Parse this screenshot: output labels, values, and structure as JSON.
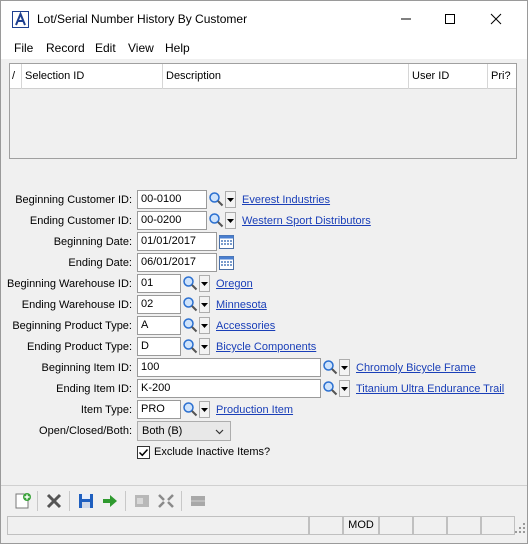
{
  "window": {
    "title": "Lot/Serial Number History By Customer"
  },
  "menu": [
    "File",
    "Record",
    "Edit",
    "View",
    "Help"
  ],
  "grid": {
    "columns": [
      "/",
      "Selection ID",
      "Description",
      "User ID",
      "Pri?"
    ]
  },
  "form": {
    "beginning_customer": {
      "label": "Beginning Customer ID:",
      "value": "00-0100",
      "link": "Everest Industries"
    },
    "ending_customer": {
      "label": "Ending Customer ID:",
      "value": "00-0200",
      "link": "Western Sport Distributors"
    },
    "beginning_date": {
      "label": "Beginning Date:",
      "value": "01/01/2017"
    },
    "ending_date": {
      "label": "Ending Date:",
      "value": "06/01/2017"
    },
    "beginning_warehouse": {
      "label": "Beginning Warehouse ID:",
      "value": "01",
      "link": "Oregon"
    },
    "ending_warehouse": {
      "label": "Ending Warehouse ID:",
      "value": "02",
      "link": "Minnesota"
    },
    "beginning_product_type": {
      "label": "Beginning Product Type:",
      "value": "A",
      "link": "Accessories"
    },
    "ending_product_type": {
      "label": "Ending Product Type:",
      "value": "D",
      "link": "Bicycle Components"
    },
    "beginning_item": {
      "label": "Beginning Item ID:",
      "value": "100",
      "link": "Chromoly Bicycle Frame"
    },
    "ending_item": {
      "label": "Ending Item ID:",
      "value": "K-200",
      "link": "Titanium Ultra Endurance Trail"
    },
    "item_type": {
      "label": "Item Type:",
      "value": "PRO",
      "link": "Production Item"
    },
    "open_closed": {
      "label": "Open/Closed/Both:",
      "value": "Both (B)"
    },
    "exclude_inactive": {
      "label": "Exclude Inactive Items?",
      "checked": true
    }
  },
  "status": {
    "mode": "MOD"
  },
  "colors": {
    "link": "#1a3fb8",
    "lookup_icon": "#2a6fd0",
    "save_icon": "#1f5fbf",
    "go_arrow": "#2f9a2f"
  }
}
